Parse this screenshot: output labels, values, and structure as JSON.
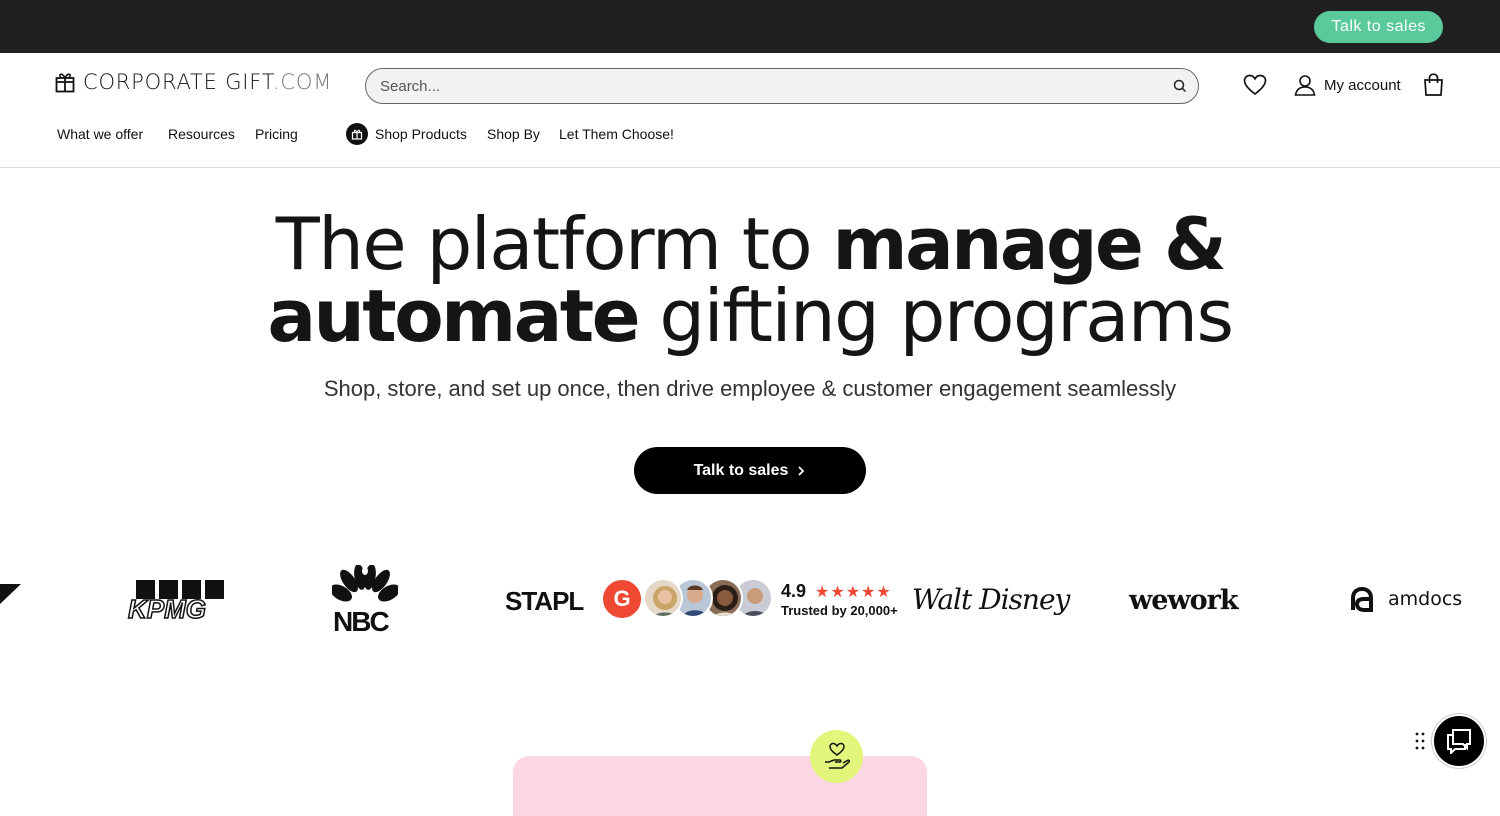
{
  "topbar": {
    "cta_label": "Talk to sales",
    "cta_color": "#5ac99b"
  },
  "header": {
    "logo_main": "CORPORATE GIFT",
    "logo_suffix": ".COM",
    "search_placeholder": "Search...",
    "account_label": "My account"
  },
  "nav": {
    "items": [
      "What we offer",
      "Resources",
      "Pricing",
      "Shop Products",
      "Shop By",
      "Let Them Choose!"
    ]
  },
  "hero": {
    "title_part1": "The platform to ",
    "title_bold1": "manage &",
    "title_bold2": "automate",
    "title_part2": " gifting programs",
    "subtitle": "Shop, store, and set up once, then drive employee & customer engagement seamlessly",
    "cta_label": "Talk to sales"
  },
  "brands": {
    "kpmg": "KPMG",
    "nbc": "NBC",
    "staples": "STAPL",
    "g2": "G",
    "rating": "4.9",
    "stars": "★★★★★",
    "trusted": "Trusted by 20,000+",
    "disney": "Walt Disney",
    "wework": "wework",
    "amdocs": "amdocs"
  },
  "icons": [
    "gift-icon",
    "search-icon",
    "heart-icon",
    "user-icon",
    "bag-icon",
    "chevron-right-icon",
    "chat-icon",
    "drag-handle-icon"
  ],
  "colors": {
    "accent_green": "#5ac99b",
    "g2_red": "#ef4934",
    "pink_card": "#fbd7e3",
    "lime_bubble": "#e3f57a"
  }
}
